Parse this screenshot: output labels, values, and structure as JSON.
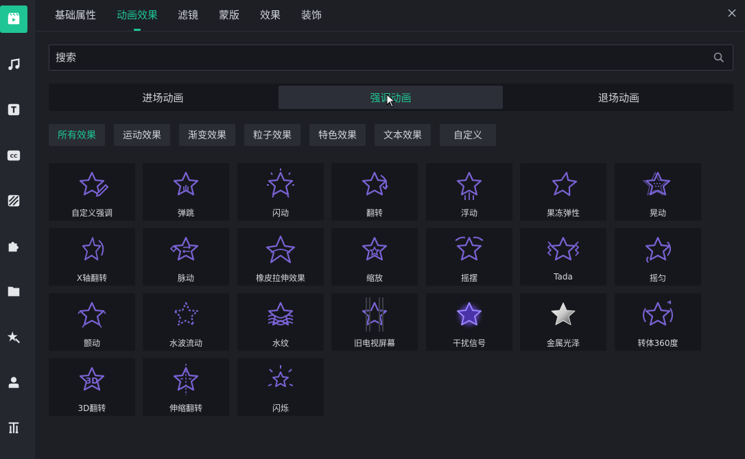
{
  "top_tabs": [
    {
      "label": "基础属性"
    },
    {
      "label": "动画效果"
    },
    {
      "label": "滤镜"
    },
    {
      "label": "蒙版"
    },
    {
      "label": "效果"
    },
    {
      "label": "装饰"
    }
  ],
  "active_top_tab": "动画效果",
  "search": {
    "placeholder": "搜索",
    "value": ""
  },
  "segment_tabs": [
    {
      "label": "进场动画"
    },
    {
      "label": "强调动画"
    },
    {
      "label": "退场动画"
    }
  ],
  "active_segment": "强调动画",
  "categories": [
    {
      "label": "所有效果"
    },
    {
      "label": "运动效果"
    },
    {
      "label": "渐变效果"
    },
    {
      "label": "粒子效果"
    },
    {
      "label": "特色效果"
    },
    {
      "label": "文本效果"
    },
    {
      "label": "自定义"
    }
  ],
  "active_category": "所有效果",
  "effects": [
    {
      "label": "自定义强调",
      "icon": "star-pencil-icon"
    },
    {
      "label": "弹跳",
      "icon": "star-bounce-icon"
    },
    {
      "label": "闪动",
      "icon": "star-flash-icon"
    },
    {
      "label": "翻转",
      "icon": "star-flip-icon"
    },
    {
      "label": "浮动",
      "icon": "star-float-icon"
    },
    {
      "label": "果冻弹性",
      "icon": "star-jelly-icon"
    },
    {
      "label": "晃动",
      "icon": "star-shake-icon"
    },
    {
      "label": "X轴翻转",
      "icon": "star-x-flip-icon"
    },
    {
      "label": "脉动",
      "icon": "star-pulse-icon"
    },
    {
      "label": "橡皮拉伸效果",
      "icon": "star-rubber-icon"
    },
    {
      "label": "缩放",
      "icon": "star-zoom-icon"
    },
    {
      "label": "摇摆",
      "icon": "star-swing-icon"
    },
    {
      "label": "Tada",
      "icon": "star-tada-icon"
    },
    {
      "label": "摇匀",
      "icon": "star-wobble-icon"
    },
    {
      "label": "颤动",
      "icon": "star-tremble-icon"
    },
    {
      "label": "水波流动",
      "icon": "star-wave-flow-icon"
    },
    {
      "label": "水纹",
      "icon": "star-ripple-icon"
    },
    {
      "label": "旧电视屏幕",
      "icon": "star-old-tv-icon"
    },
    {
      "label": "干扰信号",
      "icon": "star-glitch-icon"
    },
    {
      "label": "金属光泽",
      "icon": "star-metal-icon"
    },
    {
      "label": "转体360度",
      "icon": "star-rotate-icon"
    },
    {
      "label": "3D翻转",
      "icon": "star-3d-icon"
    },
    {
      "label": "伸缩翻转",
      "icon": "star-stretch-icon"
    },
    {
      "label": "闪烁",
      "icon": "star-twinkle-icon"
    }
  ],
  "sidebar": [
    {
      "icon": "media-clip-icon"
    },
    {
      "icon": "music-icon"
    },
    {
      "icon": "text-icon"
    },
    {
      "icon": "subtitle-cc-icon"
    },
    {
      "icon": "transition-icon"
    },
    {
      "icon": "puzzle-effects-icon"
    },
    {
      "icon": "folder-icon"
    },
    {
      "icon": "sticker-icon"
    },
    {
      "icon": "avatar-icon"
    },
    {
      "icon": "title-text-icon"
    }
  ],
  "colors": {
    "accent": "#1fc594",
    "icon_purple": "#7b63d6"
  }
}
